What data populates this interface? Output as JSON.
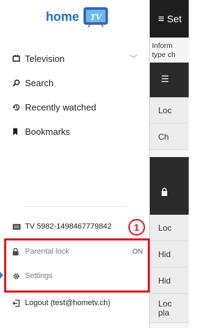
{
  "app_bar": {
    "menu_icon": "hamburger-icon",
    "title": "Set"
  },
  "content": {
    "info_text_1": "Inform",
    "info_text_2": "type ch",
    "list_icon": "list-icon",
    "rows_1": [
      "Loc",
      "Ch"
    ],
    "lock_icon": "lock-icon",
    "rows_2": [
      "Loc",
      "Hid",
      "Hid"
    ],
    "row_last_1": "Loc",
    "row_last_2": "pla"
  },
  "drawer": {
    "logo_text": "home",
    "logo_badge": "TV",
    "nav": [
      {
        "label": "Television",
        "icon": "tv-icon",
        "has_chevron": true
      },
      {
        "label": "Search",
        "icon": "search-icon"
      },
      {
        "label": "Recently watched",
        "icon": "history-icon"
      },
      {
        "label": "Bookmarks",
        "icon": "bookmark-icon"
      }
    ],
    "device": {
      "label": "TV 5982-1498467779842",
      "icon": "device-icon"
    },
    "parental_lock": {
      "label": "Parental lock",
      "status": "ON",
      "icon": "lock-icon"
    },
    "settings": {
      "label": "Settings",
      "icon": "gear-icon"
    },
    "logout": {
      "label": "Logout (test@hometv.ch)",
      "icon": "logout-icon"
    }
  },
  "annotation": {
    "callout_number": "1",
    "highlight_color": "#e0141c"
  },
  "colors": {
    "brand": "#1f6fc5",
    "app_bar": "#1f1f1f",
    "active_indicator": "#2f7fd8"
  }
}
